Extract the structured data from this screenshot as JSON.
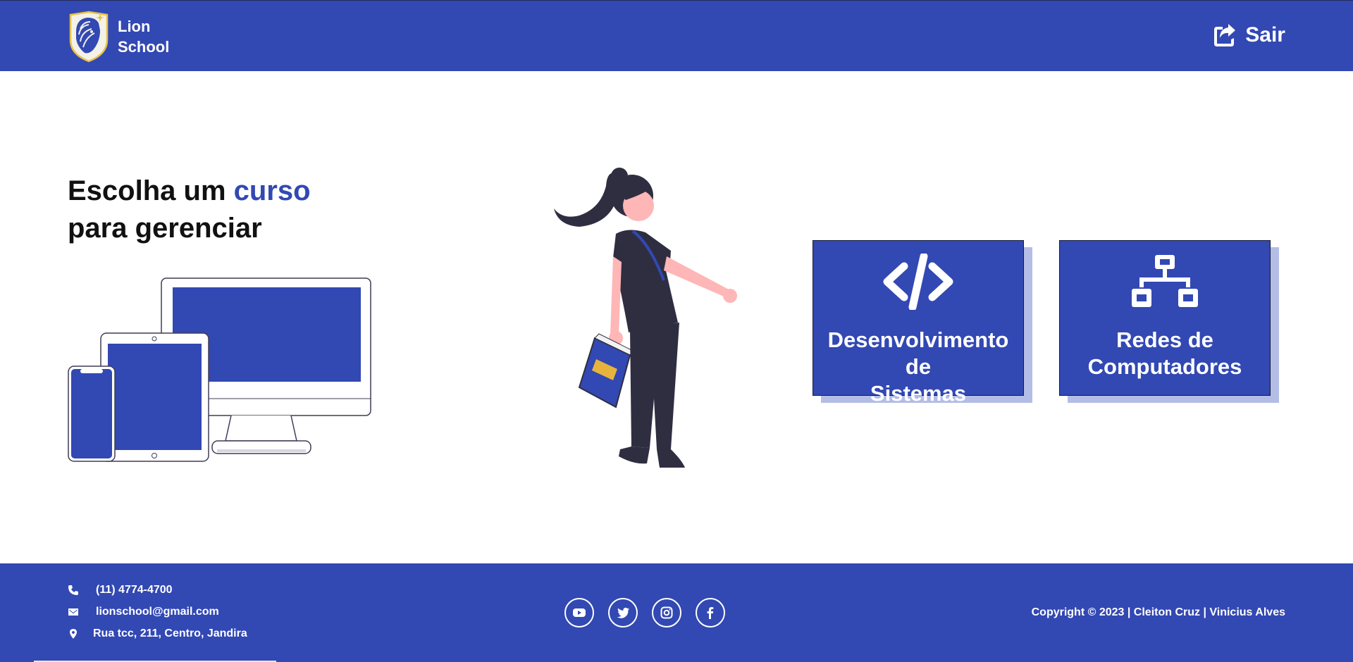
{
  "colors": {
    "primary": "#3248b3",
    "dark": "#2f2e41",
    "skin": "#ffb6b6",
    "book_tag": "#e6b33d",
    "white": "#ffffff"
  },
  "header": {
    "brand_line1": "Lion",
    "brand_line2": "School",
    "logo_icon": "lion-shield-logo",
    "logout_label": "Sair",
    "logout_icon": "share-exit-icon"
  },
  "hero": {
    "title_part1": "Escolha um ",
    "title_accent": "curso",
    "title_part2": "para gerenciar",
    "illustration_left": "devices-illustration",
    "illustration_center": "woman-with-book-illustration"
  },
  "courses": [
    {
      "icon": "code-icon",
      "label_line1": "Desenvolvimento de",
      "label_line2": "Sistemas"
    },
    {
      "icon": "network-icon",
      "label_line1": "Redes de",
      "label_line2": "Computadores"
    }
  ],
  "footer": {
    "phone": "(11) 4774-4700",
    "email": "lionschool@gmail.com",
    "address": "Rua tcc, 211, Centro, Jandira",
    "social": [
      "youtube-icon",
      "twitter-icon",
      "instagram-icon",
      "facebook-icon"
    ],
    "copyright": "Copyright © 2023 | Cleiton Cruz | Vinicius Alves"
  }
}
